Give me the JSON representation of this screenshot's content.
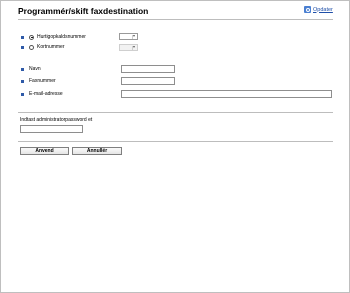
{
  "header": {
    "title": "Programmér/skift faxdestination",
    "refresh_label": "Opdater"
  },
  "destination": {
    "option_registration_no": "Hurtigopkaldsnummer",
    "option_card_no": "Kortnummer"
  },
  "fields": {
    "name_label": "Navn",
    "fax_label": "Faxnummer",
    "email_label": "E-mail-adresse"
  },
  "admin": {
    "password_label": "Indtast administratorpassword et"
  },
  "buttons": {
    "apply_label": "Anvend",
    "cancel_label": "Annullér"
  }
}
